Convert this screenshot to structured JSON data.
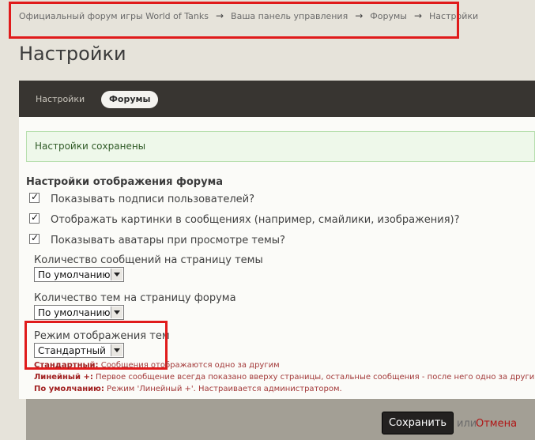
{
  "breadcrumb": {
    "items": [
      "Официальный форум игры World of Tanks",
      "Ваша панель управления",
      "Форумы",
      "Настройки"
    ],
    "separator": "→"
  },
  "page_title": "Настройки",
  "tabs": [
    {
      "label": "Настройки",
      "active": false
    },
    {
      "label": "Форумы",
      "active": true
    }
  ],
  "notice": "Настройки сохранены",
  "section": {
    "title": "Настройки отображения форума",
    "checkboxes": [
      {
        "label": "Показывать подписи пользователей?",
        "checked": true
      },
      {
        "label": "Отображать картинки в сообщениях (например, смайлики, изображения)?",
        "checked": true
      },
      {
        "label": "Показывать аватары при просмотре темы?",
        "checked": true
      }
    ],
    "fields": [
      {
        "label": "Количество сообщений на страницу темы",
        "value": "По умолчанию"
      },
      {
        "label": "Количество тем на страницу форума",
        "value": "По умолчанию"
      },
      {
        "label": "Режим отображения тем",
        "value": "Стандартный"
      }
    ],
    "hints": [
      {
        "term": "Стандартный:",
        "text": " Сообщения отображаются одно за другим"
      },
      {
        "term": "Линейный +:",
        "text": " Первое сообщение всегда показано вверху страницы, остальные сообщения - после него одно за другим."
      },
      {
        "term": "По умолчанию:",
        "text": " Режим 'Линейный +'. Настраивается администратором."
      }
    ]
  },
  "actions": {
    "save": "Сохранить",
    "or": "или",
    "cancel": "Отмена"
  },
  "colors": {
    "highlight_box": "#e01b1b",
    "tab_bar": "#383531",
    "footer": "#a39f95"
  }
}
